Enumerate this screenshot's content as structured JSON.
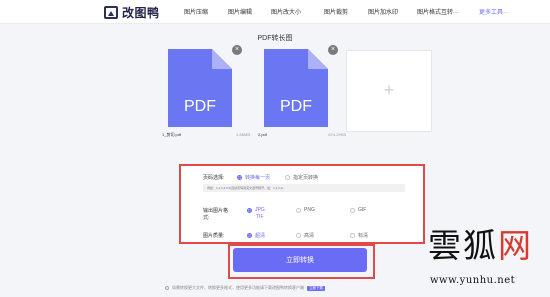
{
  "header": {
    "logo_text": "改图鸭",
    "nav": [
      "图片压缩",
      "图片编辑",
      "图片改大小",
      "图片裁剪",
      "图片加水印",
      "图片格式互转···"
    ],
    "more": "更多工具···"
  },
  "title": "PDF转长图",
  "files": [
    {
      "name": "1_剪切.pdf",
      "size": "2.86MB",
      "badge": "PDF"
    },
    {
      "name": "2.pdf",
      "size": "674.29KB",
      "badge": "PDF"
    }
  ],
  "add_symbol": "+",
  "settings": {
    "page_label": "页码选择:",
    "page_options": [
      {
        "label": "转换每一页",
        "selected": true
      },
      {
        "label": "指定页转换",
        "selected": false
      }
    ],
    "page_placeholder": "例如：1,2,3,4,5,6(连续页码用英文逗号隔开，如：1,2,3,4)",
    "format_label_1": "输出图片格",
    "format_label_2": "式:",
    "format_options": [
      {
        "label": "JPG",
        "selected": true
      },
      {
        "label": "PNG",
        "selected": false
      },
      {
        "label": "GIF",
        "selected": false
      }
    ],
    "format_extra": "TIF",
    "quality_label": "图片质量:",
    "quality_options": [
      {
        "label": "超清",
        "selected": true
      },
      {
        "label": "高清",
        "selected": false
      },
      {
        "label": "标清",
        "selected": false
      }
    ]
  },
  "convert_label": "立即转换",
  "footer": {
    "tip": "如需转换更大文件、转换更多格式，使用更多功能请下载改图鸭转换客户端",
    "download": "立即下载"
  },
  "watermark": {
    "title_main": "雲狐",
    "title_net": "网",
    "url": "www.yunhu.net"
  },
  "colors": {
    "accent": "#6a6cf5",
    "pdf_blue": "#6b77f2",
    "highlight_red": "#e04a4a"
  }
}
